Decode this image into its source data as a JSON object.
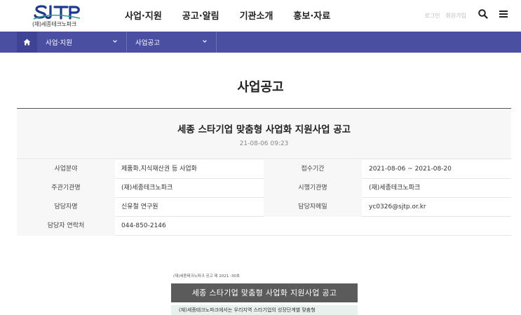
{
  "header": {
    "logo_text": "SJTP",
    "logo_sub": "(재)세종테크노파크",
    "nav": [
      "사업·지원",
      "공고·알림",
      "기관소개",
      "홍보·자료"
    ],
    "login_label": "로그인",
    "signup_label": "회원가입",
    "brand_color": "#1f3a8c",
    "brand_accent": "#2a9b8e"
  },
  "subnav": {
    "home_icon": "home-icon",
    "depth1": "사업·지원",
    "depth2": "사업공고",
    "bar_color": "#4a4fa2"
  },
  "page": {
    "title": "사업공고"
  },
  "post": {
    "title": "세종 스타기업 맞춤형 사업화 지원사업 공고",
    "date": "21-08-06 09:23"
  },
  "info": {
    "rows": [
      {
        "th1": "사업분야",
        "td1": "제품화,지식재산권 등 사업화",
        "th2": "접수기간",
        "td2": "2021-08-06 ~ 2021-08-20"
      },
      {
        "th1": "주관기관명",
        "td1": "(재)세종테크노파크",
        "th2": "시행기관명",
        "td2": "(재)세종테크노파크"
      },
      {
        "th1": "담당자명",
        "td1": "신유철 연구원",
        "th2": "담당자메일",
        "td2": "yc0326@sjtp.or.kr"
      },
      {
        "th1": "담당자 연락처",
        "td1": "044-850-2146"
      }
    ]
  },
  "document": {
    "doc_number": "(재)세종테크노파크 공고 제 2021 -30호",
    "banner": "세종 스타기업 맞춤형 사업화 지원사업 공고",
    "body_line": "(재)세종테크노파크에서는 우리지역 스타기업의 성장단계별 맞춤형"
  }
}
